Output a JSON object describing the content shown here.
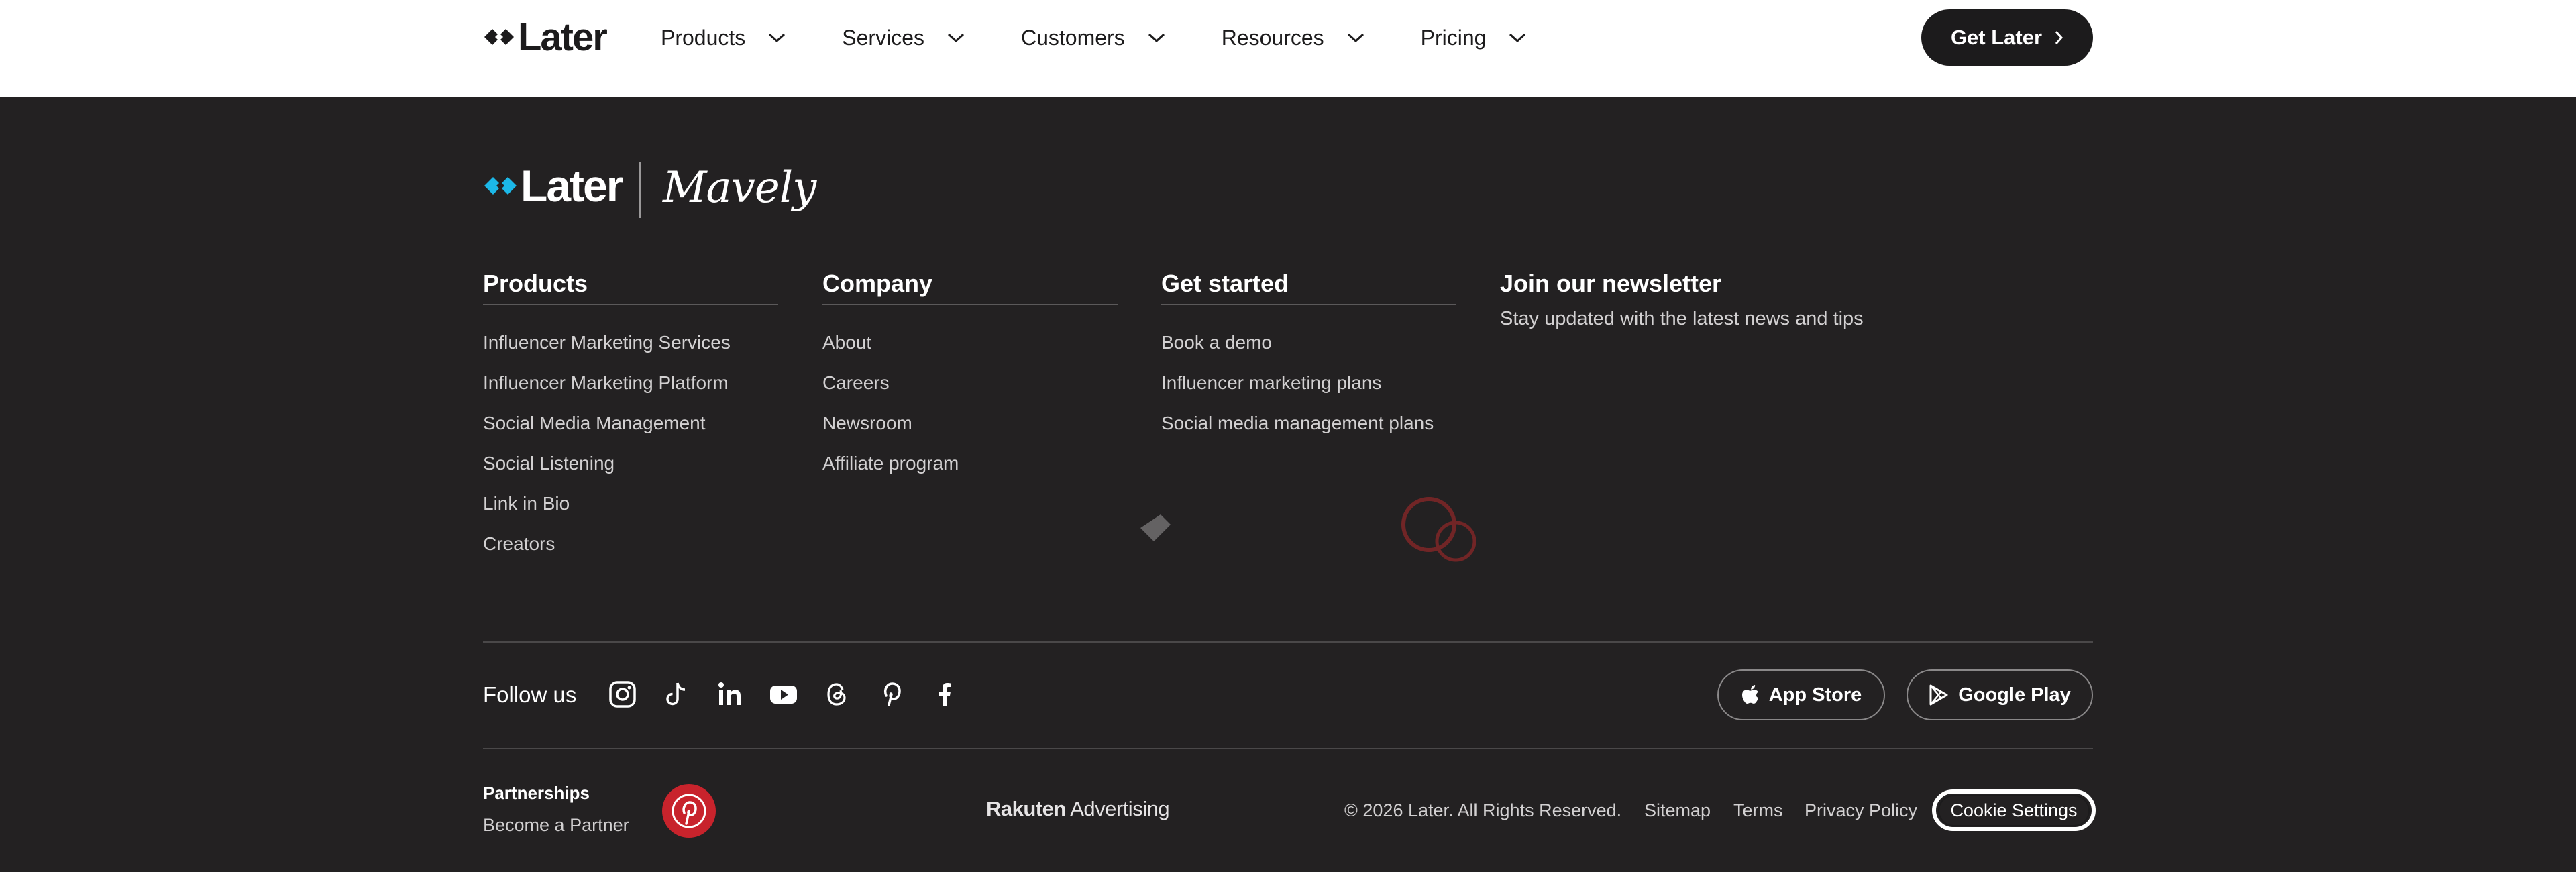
{
  "header": {
    "logo_text": "Later",
    "nav": [
      {
        "label": "Products"
      },
      {
        "label": "Services"
      },
      {
        "label": "Customers"
      },
      {
        "label": "Resources"
      },
      {
        "label": "Pricing"
      }
    ],
    "cta_label": "Get Later"
  },
  "footer": {
    "logo_text": "Later",
    "partner_brand": "Mavely",
    "columns": [
      {
        "title": "Products",
        "links": [
          "Influencer Marketing Services",
          "Influencer Marketing Platform",
          "Social Media Management",
          "Social Listening",
          "Link in Bio",
          "Creators"
        ]
      },
      {
        "title": "Company",
        "links": [
          "About",
          "Careers",
          "Newsroom",
          "Affiliate program"
        ]
      },
      {
        "title": "Get started",
        "links": [
          "Book a demo",
          "Influencer marketing plans",
          "Social media management plans"
        ]
      }
    ],
    "newsletter": {
      "title": "Join our newsletter",
      "subtitle": "Stay updated with the latest news and tips"
    },
    "follow_label": "Follow us",
    "social_icons": [
      "instagram-icon",
      "tiktok-icon",
      "linkedin-icon",
      "youtube-icon",
      "threads-icon",
      "pinterest-icon",
      "facebook-icon"
    ],
    "app_store_label": "App Store",
    "google_play_label": "Google Play",
    "partnerships_title": "Partnerships",
    "become_partner": "Become a Partner",
    "rakuten_bold": "Rakuten",
    "rakuten_rest": " Advertising",
    "copyright": "© 2026 Later. All Rights Reserved.",
    "bottom_links": [
      "Sitemap",
      "Terms",
      "Privacy Policy"
    ],
    "cookie_label": "Cookie Settings"
  },
  "colors": {
    "brand_blue": "#1cb8e8",
    "footer_bg": "#232122",
    "pinterest_red": "#c8232c"
  }
}
